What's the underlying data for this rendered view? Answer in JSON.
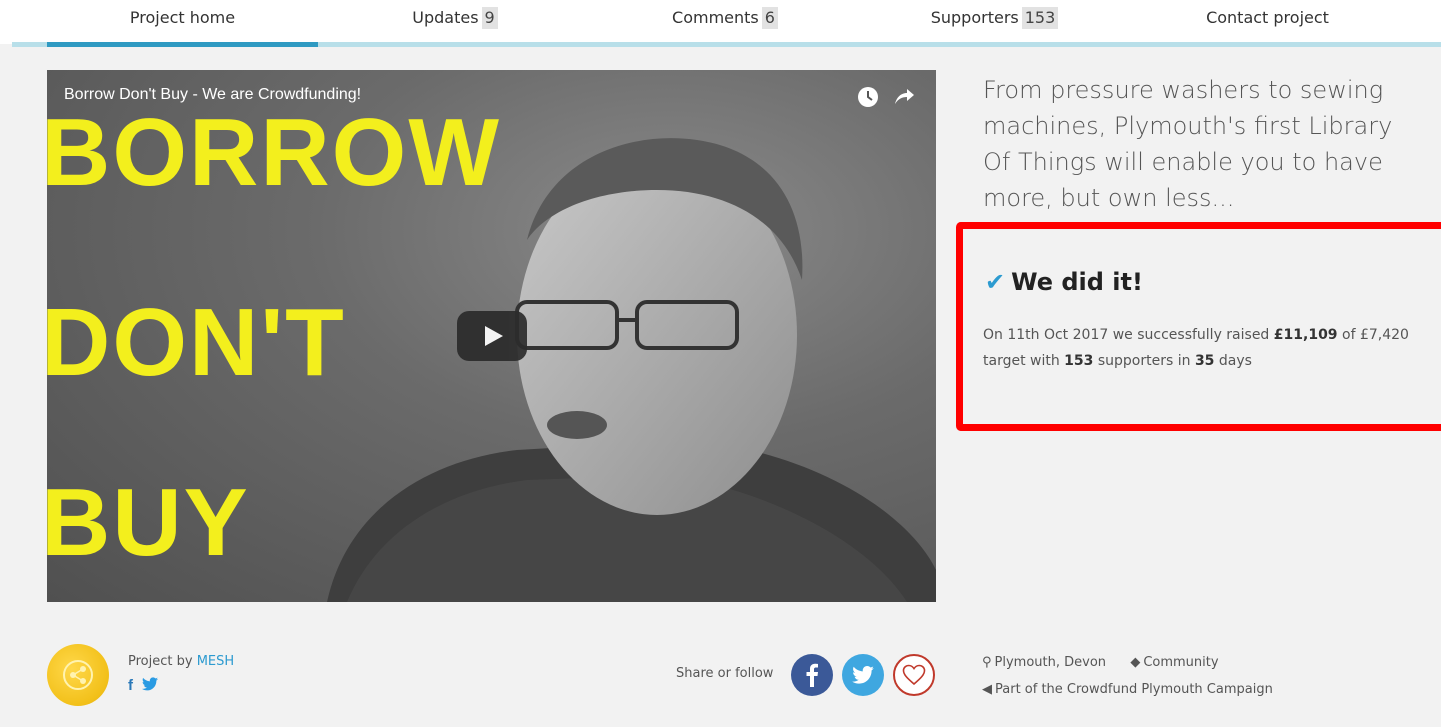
{
  "nav": {
    "tabs": [
      {
        "label": "Project home",
        "count": null
      },
      {
        "label": "Updates",
        "count": "9"
      },
      {
        "label": "Comments",
        "count": "6"
      },
      {
        "label": "Supporters",
        "count": "153"
      },
      {
        "label": "Contact project",
        "count": null
      }
    ],
    "active_index": 0
  },
  "video": {
    "title": "Borrow Don't Buy - We are Crowdfunding!",
    "words": [
      "BORROW",
      "DON'T",
      "BUY"
    ],
    "icons": [
      "clock-icon",
      "share-arrow-icon",
      "play-icon"
    ]
  },
  "pitch": "From pressure washers to sewing machines, Plymouth's first Library Of Things will enable you to have more, but own less...",
  "result": {
    "heading": "We did it!",
    "text_before": "On 11th Oct 2017 we successfully raised ",
    "raised": "£11,109",
    "text_of": " of £7,420 target with ",
    "supporters": "153",
    "text_in": " supporters in ",
    "days": "35",
    "text_end": " days"
  },
  "footer": {
    "project_by_label": "Project by ",
    "project_by_name": "MESH",
    "share_label": "Share or follow",
    "location": "Plymouth, Devon",
    "category": "Community",
    "campaign": "Part of the Crowdfund Plymouth Campaign"
  },
  "colors": {
    "accent": "#2f9ac2",
    "highlight_box": "#ff0000",
    "facebook": "#3b5998",
    "twitter": "#3fa7e0",
    "video_text": "#f3ef1d"
  }
}
